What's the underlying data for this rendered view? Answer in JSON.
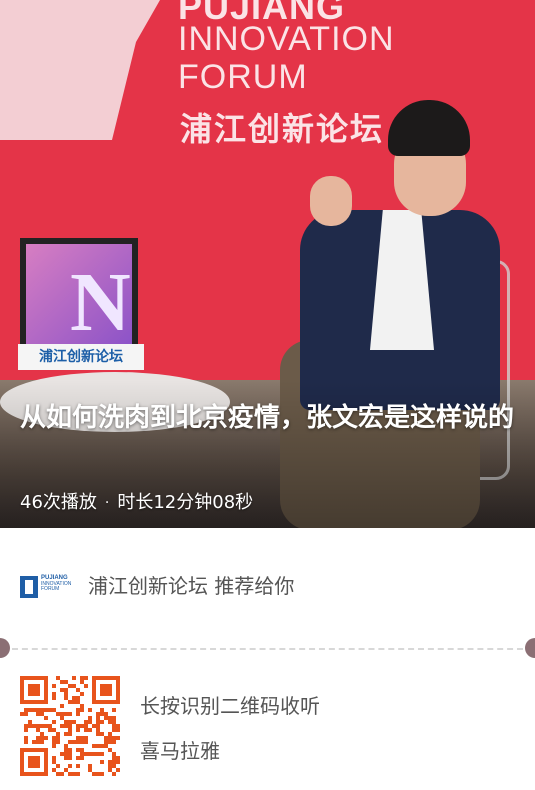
{
  "hero": {
    "backdrop": {
      "logo_line1": "PUJIANG",
      "logo_line2": "INNOVATION",
      "logo_line3": "FORUM",
      "logo_cn": "浦江创新论坛",
      "board_caption": "浦江创新论坛"
    },
    "title": "从如何洗肉到北京疫情，张文宏是这样说的",
    "plays": "46次播放",
    "separator": "·",
    "duration": "时长12分钟08秒"
  },
  "recommendation": {
    "text": "浦江创新论坛 推荐给你",
    "logo_name": "PUJIANG",
    "logo_sub": "INNOVATION FORUM"
  },
  "qr": {
    "line1": "长按识别二维码收听",
    "line2": "喜马拉雅",
    "color": "#e8541c"
  },
  "colors": {
    "accent": "#e43448",
    "brand_blue": "#1f5ea6",
    "text_gray": "#555555"
  }
}
